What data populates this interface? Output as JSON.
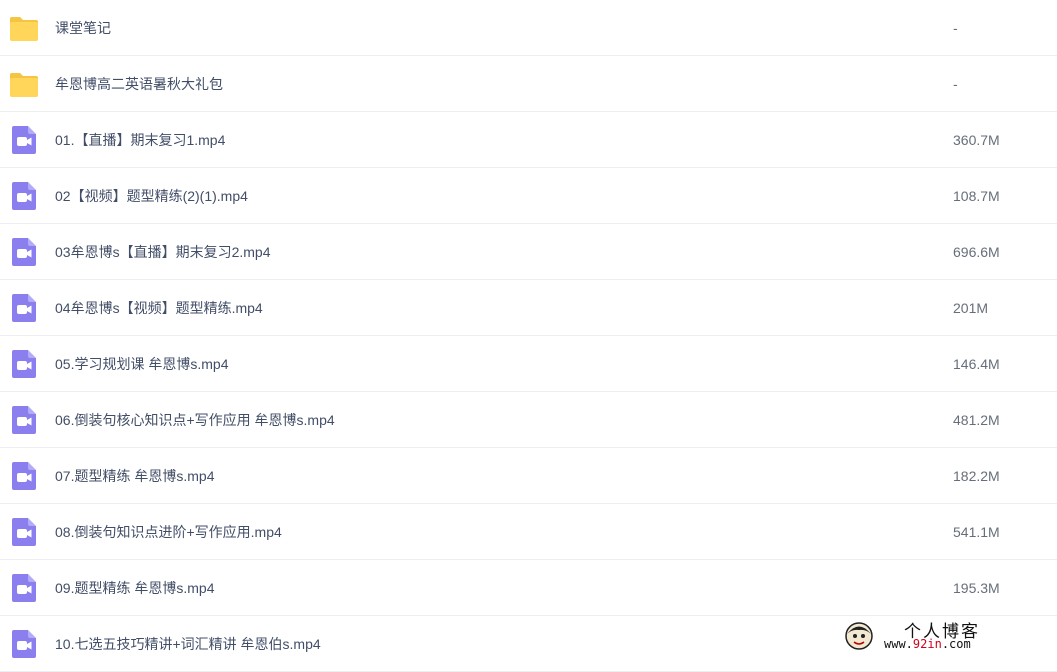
{
  "files": [
    {
      "type": "folder",
      "name": "课堂笔记",
      "size": "-"
    },
    {
      "type": "folder",
      "name": "牟恩博高二英语暑秋大礼包",
      "size": "-"
    },
    {
      "type": "video",
      "name": "01.【直播】期末复习1.mp4",
      "size": "360.7M"
    },
    {
      "type": "video",
      "name": "02【视频】题型精练(2)(1).mp4",
      "size": "108.7M"
    },
    {
      "type": "video",
      "name": "03牟恩博s【直播】期末复习2.mp4",
      "size": "696.6M"
    },
    {
      "type": "video",
      "name": "04牟恩博s【视频】题型精练.mp4",
      "size": "201M"
    },
    {
      "type": "video",
      "name": "05.学习规划课 牟恩博s.mp4",
      "size": "146.4M"
    },
    {
      "type": "video",
      "name": "06.倒装句核心知识点+写作应用 牟恩博s.mp4",
      "size": "481.2M"
    },
    {
      "type": "video",
      "name": "07.题型精练 牟恩博s.mp4",
      "size": "182.2M"
    },
    {
      "type": "video",
      "name": "08.倒装句知识点进阶+写作应用.mp4",
      "size": "541.1M"
    },
    {
      "type": "video",
      "name": "09.题型精练 牟恩博s.mp4",
      "size": "195.3M"
    },
    {
      "type": "video",
      "name": "10.七选五技巧精讲+词汇精讲 牟恩伯s.mp4",
      "size": ""
    }
  ],
  "watermark": {
    "title": "个人博客",
    "url_prefix": "www.",
    "url_highlight": "92in",
    "url_suffix": ".com"
  },
  "colors": {
    "folder": "#ffd659",
    "folder_tab": "#f5c443",
    "video": "#8b7ff0",
    "divider": "#eceef1"
  },
  "icons": {
    "folder": "folder-icon",
    "video": "video-file-icon"
  }
}
